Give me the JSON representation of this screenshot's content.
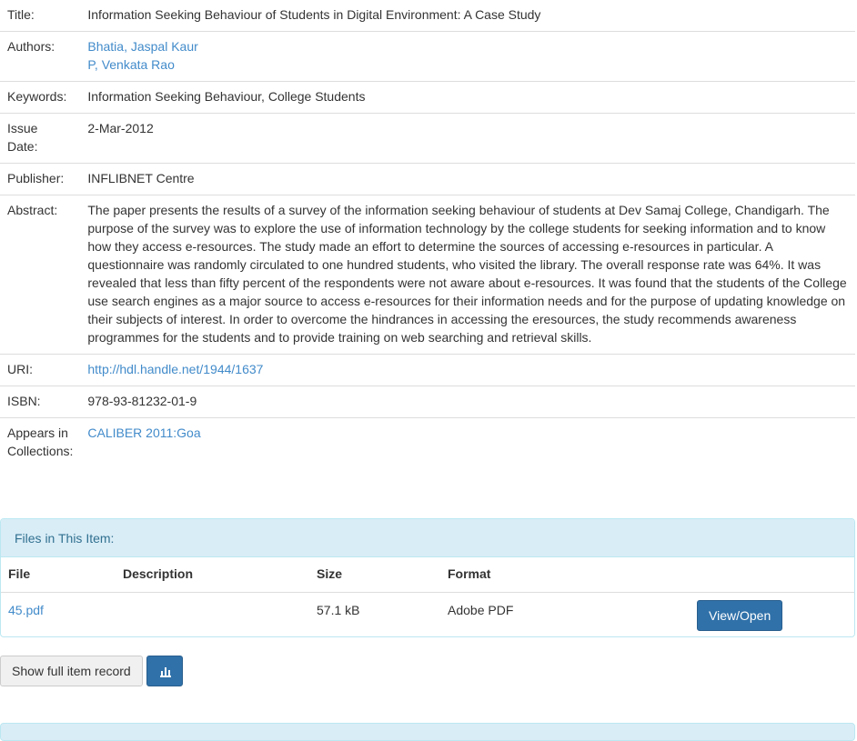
{
  "metadata": {
    "title_label": "Title:",
    "title_value": "Information Seeking Behaviour of Students in Digital Environment: A Case Study",
    "authors_label": "Authors:",
    "authors": [
      "Bhatia, Jaspal Kaur",
      "P, Venkata Rao"
    ],
    "keywords_label": "Keywords:",
    "keywords_value": "Information Seeking Behaviour, College Students",
    "issue_date_label_1": "Issue",
    "issue_date_label_2": "Date:",
    "issue_date_value": "2-Mar-2012",
    "publisher_label": "Publisher:",
    "publisher_value": "INFLIBNET Centre",
    "abstract_label": "Abstract:",
    "abstract_value": "The paper presents the results of a survey of the information seeking behaviour of students at Dev Samaj College, Chandigarh. The purpose of the survey was to explore the use of information technology by the college students for seeking information and to know how they access e-resources. The study made an effort to determine the sources of accessing e-resources in particular. A questionnaire was randomly circulated to one hundred students, who visited the library. The overall response rate was 64%. It was revealed that less than fifty percent of the respondents were not aware about e-resources. It was found that the students of the College use search engines as a major source to access e-resources for their information needs and for the purpose of updating knowledge on their subjects of interest. In order to overcome the hindrances in accessing the eresources, the study recommends awareness programmes for the students and to provide training on web searching and retrieval skills.",
    "uri_label": "URI:",
    "uri_value": "http://hdl.handle.net/1944/1637",
    "isbn_label": "ISBN:",
    "isbn_value": "978-93-81232-01-9",
    "collections_label_1": "Appears in",
    "collections_label_2": "Collections:",
    "collections_value": "CALIBER 2011:Goa"
  },
  "files": {
    "heading": "Files in This Item:",
    "columns": [
      "File",
      "Description",
      "Size",
      "Format"
    ],
    "rows": [
      {
        "file": "45.pdf",
        "description": "",
        "size": "57.1 kB",
        "format": "Adobe PDF",
        "action": "View/Open"
      }
    ]
  },
  "actions": {
    "full_record_label": "Show full item record",
    "stats_icon": "bar-chart-icon"
  },
  "colors": {
    "link": "#428bca",
    "primary_button": "#3071a9",
    "panel_heading_bg": "#d9edf7",
    "panel_heading_text": "#31708f"
  }
}
